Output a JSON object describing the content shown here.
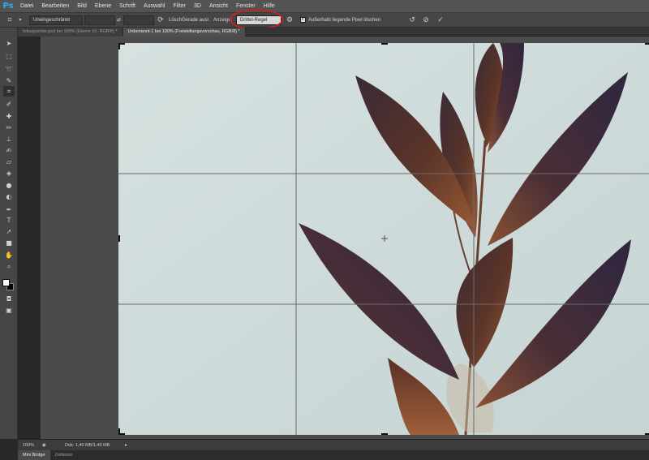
{
  "app": {
    "logo": "Ps",
    "menu": [
      "Datei",
      "Bearbeiten",
      "Bild",
      "Ebene",
      "Schrift",
      "Auswahl",
      "Filter",
      "3D",
      "Ansicht",
      "Fenster",
      "Hilfe"
    ]
  },
  "options_bar": {
    "ratio_select": "Uneingeschränkt",
    "swap_symbol": "⇄",
    "reset_label": "Lösch",
    "straighten_label": "Gerade ausr.",
    "overlay_label": "Anzeige:",
    "overlay_select": "Drittel-Regel",
    "delete_pixels_label": "Außerhalb liegende Pixel löschen",
    "delete_pixels_checked": true
  },
  "tabs": [
    {
      "label": "fokuspunkte.psd bei 100% (Ebene 10, RGB/8) *",
      "active": false
    },
    {
      "label": "Unbenannt-1 bei 100% (Freistellungsvorschau, RGB/8) *",
      "active": true
    }
  ],
  "status_bar": {
    "zoom": "100%",
    "doc_info": "Dok: 1,40 MB/1,40 MB"
  },
  "bottom_panel": {
    "tabs": [
      {
        "label": "Mini Bridge",
        "active": true
      },
      {
        "label": "Zeitleiste",
        "active": false
      }
    ]
  },
  "colors": {
    "foreground": "#ffffff",
    "background": "#000000",
    "canvas_bg": "#cfdcdc",
    "annotation": "#c81f1f"
  }
}
